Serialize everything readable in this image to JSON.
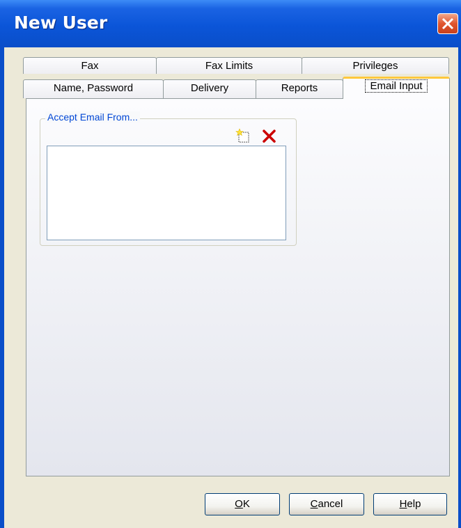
{
  "window": {
    "title": "New User"
  },
  "tabs_row1": [
    {
      "label": "Fax"
    },
    {
      "label": "Fax Limits"
    },
    {
      "label": "Privileges"
    }
  ],
  "tabs_row2": [
    {
      "label": "Name, Password"
    },
    {
      "label": "Delivery"
    },
    {
      "label": "Reports"
    },
    {
      "label": "Email Input",
      "active": true
    }
  ],
  "email_input": {
    "group_label": "Accept Email From...",
    "add_icon": "new-item-icon",
    "delete_icon": "delete-x-icon",
    "list_items": []
  },
  "buttons": {
    "ok": {
      "mnemonic": "O",
      "rest": "K"
    },
    "cancel": {
      "mnemonic": "C",
      "rest": "ancel"
    },
    "help": {
      "mnemonic": "H",
      "rest": "elp"
    }
  },
  "colors": {
    "title_bar": "#0b55d8",
    "close_button": "#e0552e",
    "active_tab_accent": "#ffc83c",
    "group_label": "#0046d5",
    "delete_icon": "#cc0000"
  }
}
